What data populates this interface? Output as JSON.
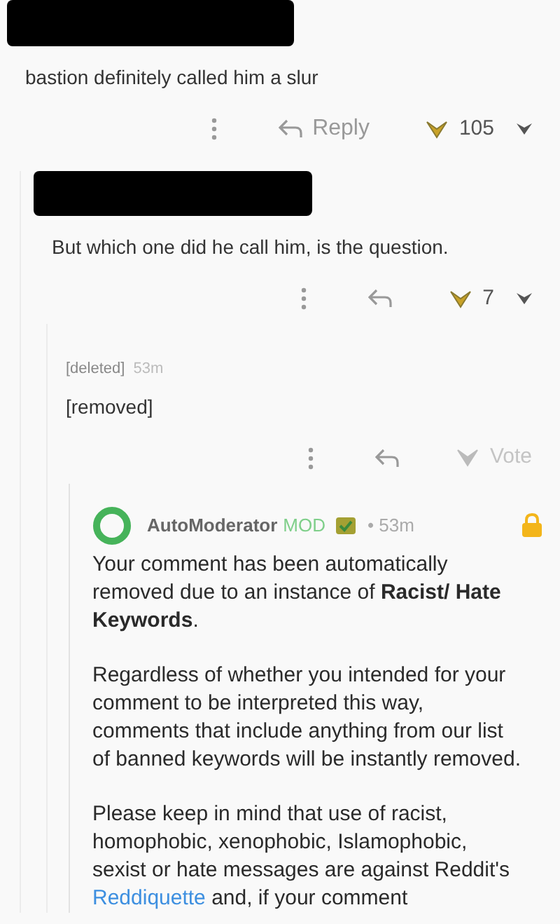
{
  "thread": {
    "author_redacted": true,
    "body": "bastion definitely called him a slur",
    "actions": {
      "kind": "score",
      "reply_label": "Reply",
      "score": "105",
      "upvoted": true
    },
    "children": [
      {
        "author_redacted": true,
        "body": "But which one did he call him, is the question.",
        "actions": {
          "kind": "score",
          "score": "7",
          "upvoted": true
        },
        "children": [
          {
            "author": "[deleted]",
            "time": "53m",
            "body": "[removed]",
            "actions": {
              "kind": "vote",
              "score": "Vote",
              "upvoted": false
            },
            "children": [
              {
                "kind": "mod",
                "author": "AutoModerator",
                "flair": "MOD",
                "time": "• 53m",
                "locked": true,
                "paragraphs": [
                  [
                    {
                      "kind": "text",
                      "text": "Your comment has been automatically removed due to an instance of **Racist/ Hate Keywords**."
                    }
                  ],
                  [
                    {
                      "kind": "text",
                      "text": "Regardless of whether you intended for your comment to be interpreted this way, comments that include anything from our list of banned keywords will be instantly removed."
                    }
                  ],
                  [
                    {
                      "kind": "text",
                      "text": "Please keep in mind that use of racist, homophobic, xenophobic, Islamophobic, sexist or hate messages are against Reddit's "
                    },
                    {
                      "kind": "link",
                      "text": "Reddiquette"
                    },
                    {
                      "kind": "text",
                      "text": " and, if your comment"
                    }
                  ]
                ]
              }
            ]
          }
        ]
      }
    ]
  }
}
